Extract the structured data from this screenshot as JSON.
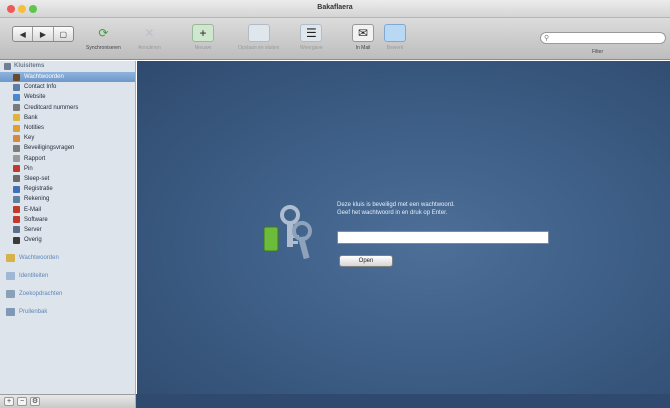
{
  "window": {
    "title": "Bakaflaera"
  },
  "toolbar": {
    "segment_labels": [
      "◀",
      "▶",
      "▢"
    ],
    "items": [
      {
        "label": "Synchroniseren",
        "icon": "sync-icon",
        "color": "#3f9d3f"
      },
      {
        "label": "Annuleren",
        "icon": "cancel-icon",
        "color": "#b7c3cc"
      },
      {
        "label": "Nieuwe",
        "icon": "new-item-icon",
        "color": "#9fd0a0"
      },
      {
        "label": "Opslaan en sluiten",
        "icon": "save-icon",
        "color": "#c9d6e0"
      },
      {
        "label": "Weergave",
        "icon": "view-icon",
        "color": "#c9d6e0"
      },
      {
        "label": "In Mail",
        "icon": "mail-icon",
        "color": "#e8e8e8"
      },
      {
        "label": "Bewerk",
        "icon": "edit-icon",
        "color": "#9ec7f0"
      }
    ],
    "search_placeholder": "",
    "filter_label": "Filter"
  },
  "sidebar": {
    "header": "Kluisitems",
    "items": [
      {
        "label": "Wachtwoorden",
        "color": "#6b4a2a"
      },
      {
        "label": "Contact Info",
        "color": "#5b7da8"
      },
      {
        "label": "Website",
        "color": "#4e88c7"
      },
      {
        "label": "Creditcard nummers",
        "color": "#7a7a7a"
      },
      {
        "label": "Bank",
        "color": "#e0b43a"
      },
      {
        "label": "Notities",
        "color": "#e0a030"
      },
      {
        "label": "Key",
        "color": "#d48a3a"
      },
      {
        "label": "Beveiligingsvragen",
        "color": "#7d7d7d"
      },
      {
        "label": "Rapport",
        "color": "#9a9a9a"
      },
      {
        "label": "Pin",
        "color": "#c0392b"
      },
      {
        "label": "Sleep-set",
        "color": "#6a6a6a"
      },
      {
        "label": "Registratie",
        "color": "#3f6fb5"
      },
      {
        "label": "Rekening",
        "color": "#5f7f9f"
      },
      {
        "label": "E-Mail",
        "color": "#c0392b"
      },
      {
        "label": "Software",
        "color": "#c0392b"
      },
      {
        "label": "Server",
        "color": "#5b6f8a"
      },
      {
        "label": "Overig",
        "color": "#3a3a3a"
      }
    ],
    "sections": [
      {
        "label": "Wachtwoorden",
        "icon": "folder-icon",
        "color": "#d7b24a"
      },
      {
        "label": "Identiteiten",
        "icon": "folder-icon",
        "color": "#9fb6d4"
      },
      {
        "label": "Zoekopdrachten",
        "icon": "search-folder-icon",
        "color": "#8aa0b8"
      },
      {
        "label": "Prullenbak",
        "icon": "trash-icon",
        "color": "#7f98b8"
      }
    ]
  },
  "bottombar": {
    "add_label": "+",
    "remove_label": "−",
    "action_label": "⚙"
  },
  "main": {
    "line1": "Deze kluis is beveiligd met een wachtwoord.",
    "line2": "Geef het wachtwoord in en druk op Enter.",
    "password_value": "",
    "open_button": "Open"
  }
}
